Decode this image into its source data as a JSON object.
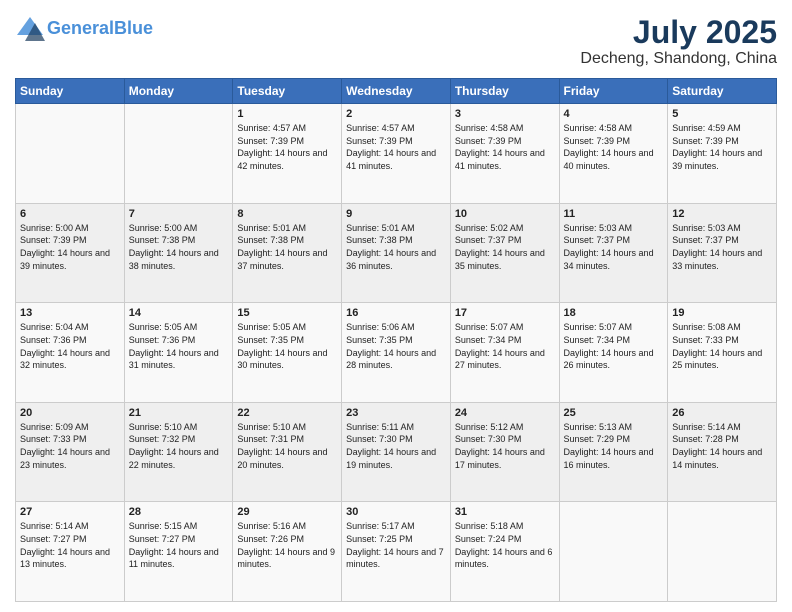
{
  "logo": {
    "line1": "General",
    "line2": "Blue"
  },
  "header": {
    "month": "July 2025",
    "location": "Decheng, Shandong, China"
  },
  "weekdays": [
    "Sunday",
    "Monday",
    "Tuesday",
    "Wednesday",
    "Thursday",
    "Friday",
    "Saturday"
  ],
  "weeks": [
    [
      {
        "day": "",
        "sunrise": "",
        "sunset": "",
        "daylight": ""
      },
      {
        "day": "",
        "sunrise": "",
        "sunset": "",
        "daylight": ""
      },
      {
        "day": "1",
        "sunrise": "Sunrise: 4:57 AM",
        "sunset": "Sunset: 7:39 PM",
        "daylight": "Daylight: 14 hours and 42 minutes."
      },
      {
        "day": "2",
        "sunrise": "Sunrise: 4:57 AM",
        "sunset": "Sunset: 7:39 PM",
        "daylight": "Daylight: 14 hours and 41 minutes."
      },
      {
        "day": "3",
        "sunrise": "Sunrise: 4:58 AM",
        "sunset": "Sunset: 7:39 PM",
        "daylight": "Daylight: 14 hours and 41 minutes."
      },
      {
        "day": "4",
        "sunrise": "Sunrise: 4:58 AM",
        "sunset": "Sunset: 7:39 PM",
        "daylight": "Daylight: 14 hours and 40 minutes."
      },
      {
        "day": "5",
        "sunrise": "Sunrise: 4:59 AM",
        "sunset": "Sunset: 7:39 PM",
        "daylight": "Daylight: 14 hours and 39 minutes."
      }
    ],
    [
      {
        "day": "6",
        "sunrise": "Sunrise: 5:00 AM",
        "sunset": "Sunset: 7:39 PM",
        "daylight": "Daylight: 14 hours and 39 minutes."
      },
      {
        "day": "7",
        "sunrise": "Sunrise: 5:00 AM",
        "sunset": "Sunset: 7:38 PM",
        "daylight": "Daylight: 14 hours and 38 minutes."
      },
      {
        "day": "8",
        "sunrise": "Sunrise: 5:01 AM",
        "sunset": "Sunset: 7:38 PM",
        "daylight": "Daylight: 14 hours and 37 minutes."
      },
      {
        "day": "9",
        "sunrise": "Sunrise: 5:01 AM",
        "sunset": "Sunset: 7:38 PM",
        "daylight": "Daylight: 14 hours and 36 minutes."
      },
      {
        "day": "10",
        "sunrise": "Sunrise: 5:02 AM",
        "sunset": "Sunset: 7:37 PM",
        "daylight": "Daylight: 14 hours and 35 minutes."
      },
      {
        "day": "11",
        "sunrise": "Sunrise: 5:03 AM",
        "sunset": "Sunset: 7:37 PM",
        "daylight": "Daylight: 14 hours and 34 minutes."
      },
      {
        "day": "12",
        "sunrise": "Sunrise: 5:03 AM",
        "sunset": "Sunset: 7:37 PM",
        "daylight": "Daylight: 14 hours and 33 minutes."
      }
    ],
    [
      {
        "day": "13",
        "sunrise": "Sunrise: 5:04 AM",
        "sunset": "Sunset: 7:36 PM",
        "daylight": "Daylight: 14 hours and 32 minutes."
      },
      {
        "day": "14",
        "sunrise": "Sunrise: 5:05 AM",
        "sunset": "Sunset: 7:36 PM",
        "daylight": "Daylight: 14 hours and 31 minutes."
      },
      {
        "day": "15",
        "sunrise": "Sunrise: 5:05 AM",
        "sunset": "Sunset: 7:35 PM",
        "daylight": "Daylight: 14 hours and 30 minutes."
      },
      {
        "day": "16",
        "sunrise": "Sunrise: 5:06 AM",
        "sunset": "Sunset: 7:35 PM",
        "daylight": "Daylight: 14 hours and 28 minutes."
      },
      {
        "day": "17",
        "sunrise": "Sunrise: 5:07 AM",
        "sunset": "Sunset: 7:34 PM",
        "daylight": "Daylight: 14 hours and 27 minutes."
      },
      {
        "day": "18",
        "sunrise": "Sunrise: 5:07 AM",
        "sunset": "Sunset: 7:34 PM",
        "daylight": "Daylight: 14 hours and 26 minutes."
      },
      {
        "day": "19",
        "sunrise": "Sunrise: 5:08 AM",
        "sunset": "Sunset: 7:33 PM",
        "daylight": "Daylight: 14 hours and 25 minutes."
      }
    ],
    [
      {
        "day": "20",
        "sunrise": "Sunrise: 5:09 AM",
        "sunset": "Sunset: 7:33 PM",
        "daylight": "Daylight: 14 hours and 23 minutes."
      },
      {
        "day": "21",
        "sunrise": "Sunrise: 5:10 AM",
        "sunset": "Sunset: 7:32 PM",
        "daylight": "Daylight: 14 hours and 22 minutes."
      },
      {
        "day": "22",
        "sunrise": "Sunrise: 5:10 AM",
        "sunset": "Sunset: 7:31 PM",
        "daylight": "Daylight: 14 hours and 20 minutes."
      },
      {
        "day": "23",
        "sunrise": "Sunrise: 5:11 AM",
        "sunset": "Sunset: 7:30 PM",
        "daylight": "Daylight: 14 hours and 19 minutes."
      },
      {
        "day": "24",
        "sunrise": "Sunrise: 5:12 AM",
        "sunset": "Sunset: 7:30 PM",
        "daylight": "Daylight: 14 hours and 17 minutes."
      },
      {
        "day": "25",
        "sunrise": "Sunrise: 5:13 AM",
        "sunset": "Sunset: 7:29 PM",
        "daylight": "Daylight: 14 hours and 16 minutes."
      },
      {
        "day": "26",
        "sunrise": "Sunrise: 5:14 AM",
        "sunset": "Sunset: 7:28 PM",
        "daylight": "Daylight: 14 hours and 14 minutes."
      }
    ],
    [
      {
        "day": "27",
        "sunrise": "Sunrise: 5:14 AM",
        "sunset": "Sunset: 7:27 PM",
        "daylight": "Daylight: 14 hours and 13 minutes."
      },
      {
        "day": "28",
        "sunrise": "Sunrise: 5:15 AM",
        "sunset": "Sunset: 7:27 PM",
        "daylight": "Daylight: 14 hours and 11 minutes."
      },
      {
        "day": "29",
        "sunrise": "Sunrise: 5:16 AM",
        "sunset": "Sunset: 7:26 PM",
        "daylight": "Daylight: 14 hours and 9 minutes."
      },
      {
        "day": "30",
        "sunrise": "Sunrise: 5:17 AM",
        "sunset": "Sunset: 7:25 PM",
        "daylight": "Daylight: 14 hours and 7 minutes."
      },
      {
        "day": "31",
        "sunrise": "Sunrise: 5:18 AM",
        "sunset": "Sunset: 7:24 PM",
        "daylight": "Daylight: 14 hours and 6 minutes."
      },
      {
        "day": "",
        "sunrise": "",
        "sunset": "",
        "daylight": ""
      },
      {
        "day": "",
        "sunrise": "",
        "sunset": "",
        "daylight": ""
      }
    ]
  ]
}
